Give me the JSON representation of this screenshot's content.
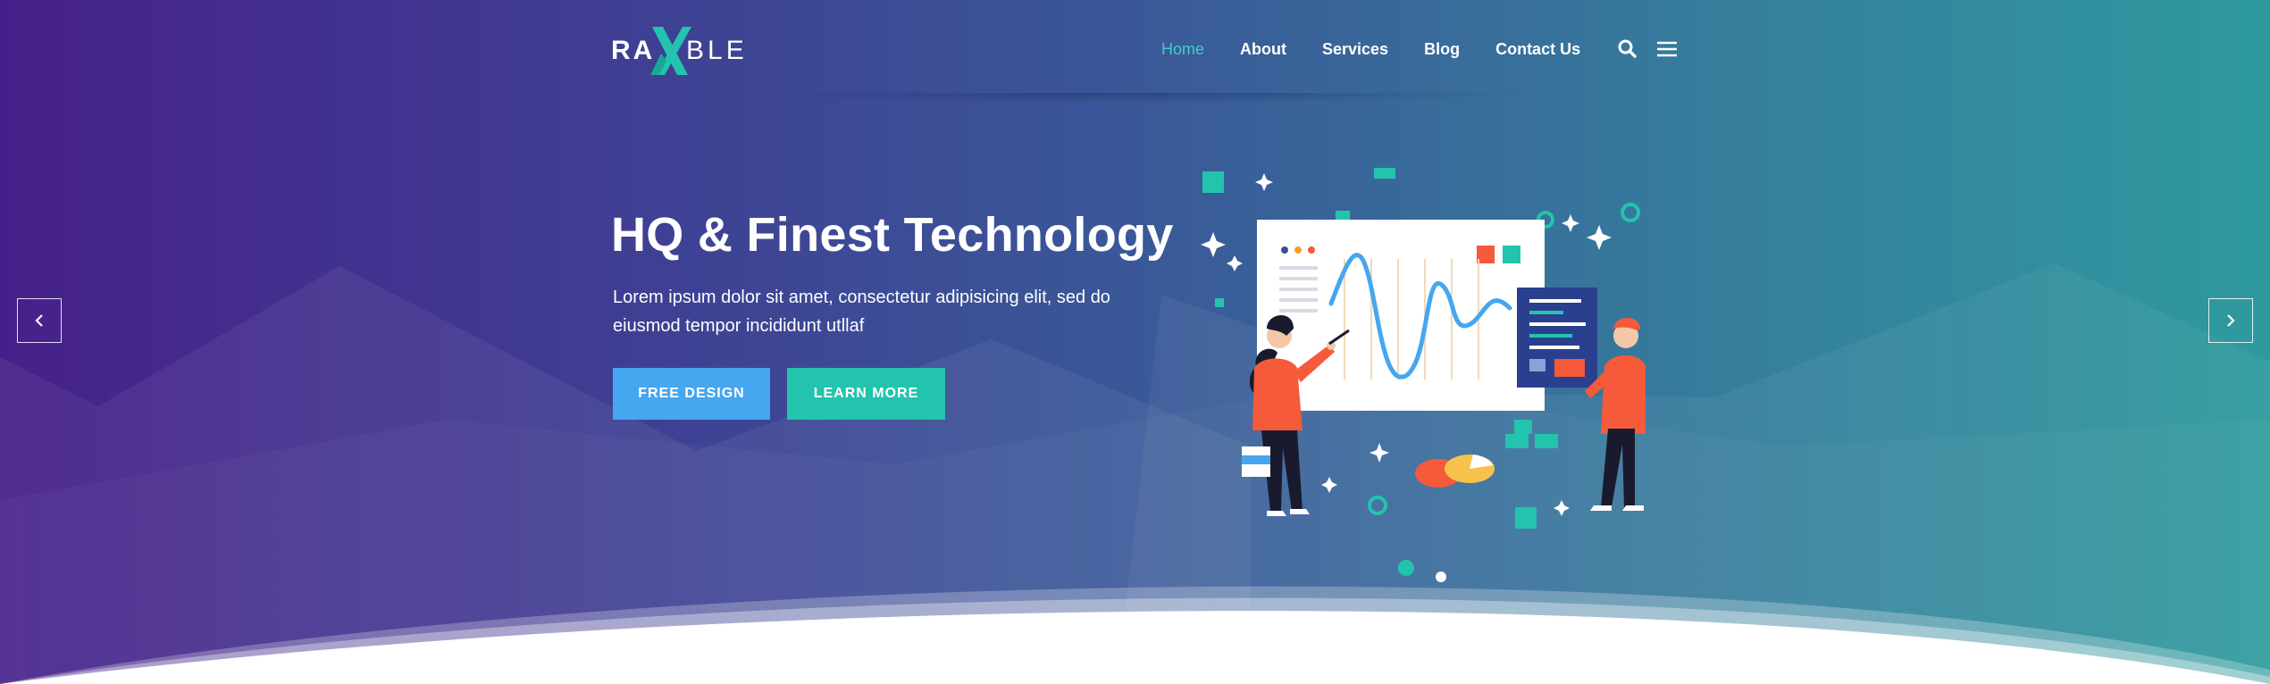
{
  "brand": {
    "logo_left": "RA",
    "logo_right": "BLE",
    "accent": "#22c4ad",
    "active_nav_color": "#3fd0c4"
  },
  "nav": {
    "items": [
      {
        "label": "Home",
        "active": true
      },
      {
        "label": "About",
        "active": false
      },
      {
        "label": "Services",
        "active": false
      },
      {
        "label": "Blog",
        "active": false
      },
      {
        "label": "Contact Us",
        "active": false
      }
    ],
    "icons": [
      "search-icon",
      "menu-icon"
    ]
  },
  "hero": {
    "title": "HQ & Finest Technology",
    "text": "Lorem ipsum dolor sit amet, consectetur adipisicing elit, sed do eiusmod tempor incididunt utllaf",
    "buttons": {
      "free_design": "FREE DESIGN",
      "learn_more": "LEARN MORE"
    },
    "button_colors": {
      "free_design": "#46a6ef",
      "learn_more": "#22c4ad"
    }
  },
  "slider": {
    "prev_icon": "chevron-left-icon",
    "next_icon": "chevron-right-icon"
  },
  "gradient": {
    "from": "#46208a",
    "to": "#2e9a9e"
  }
}
